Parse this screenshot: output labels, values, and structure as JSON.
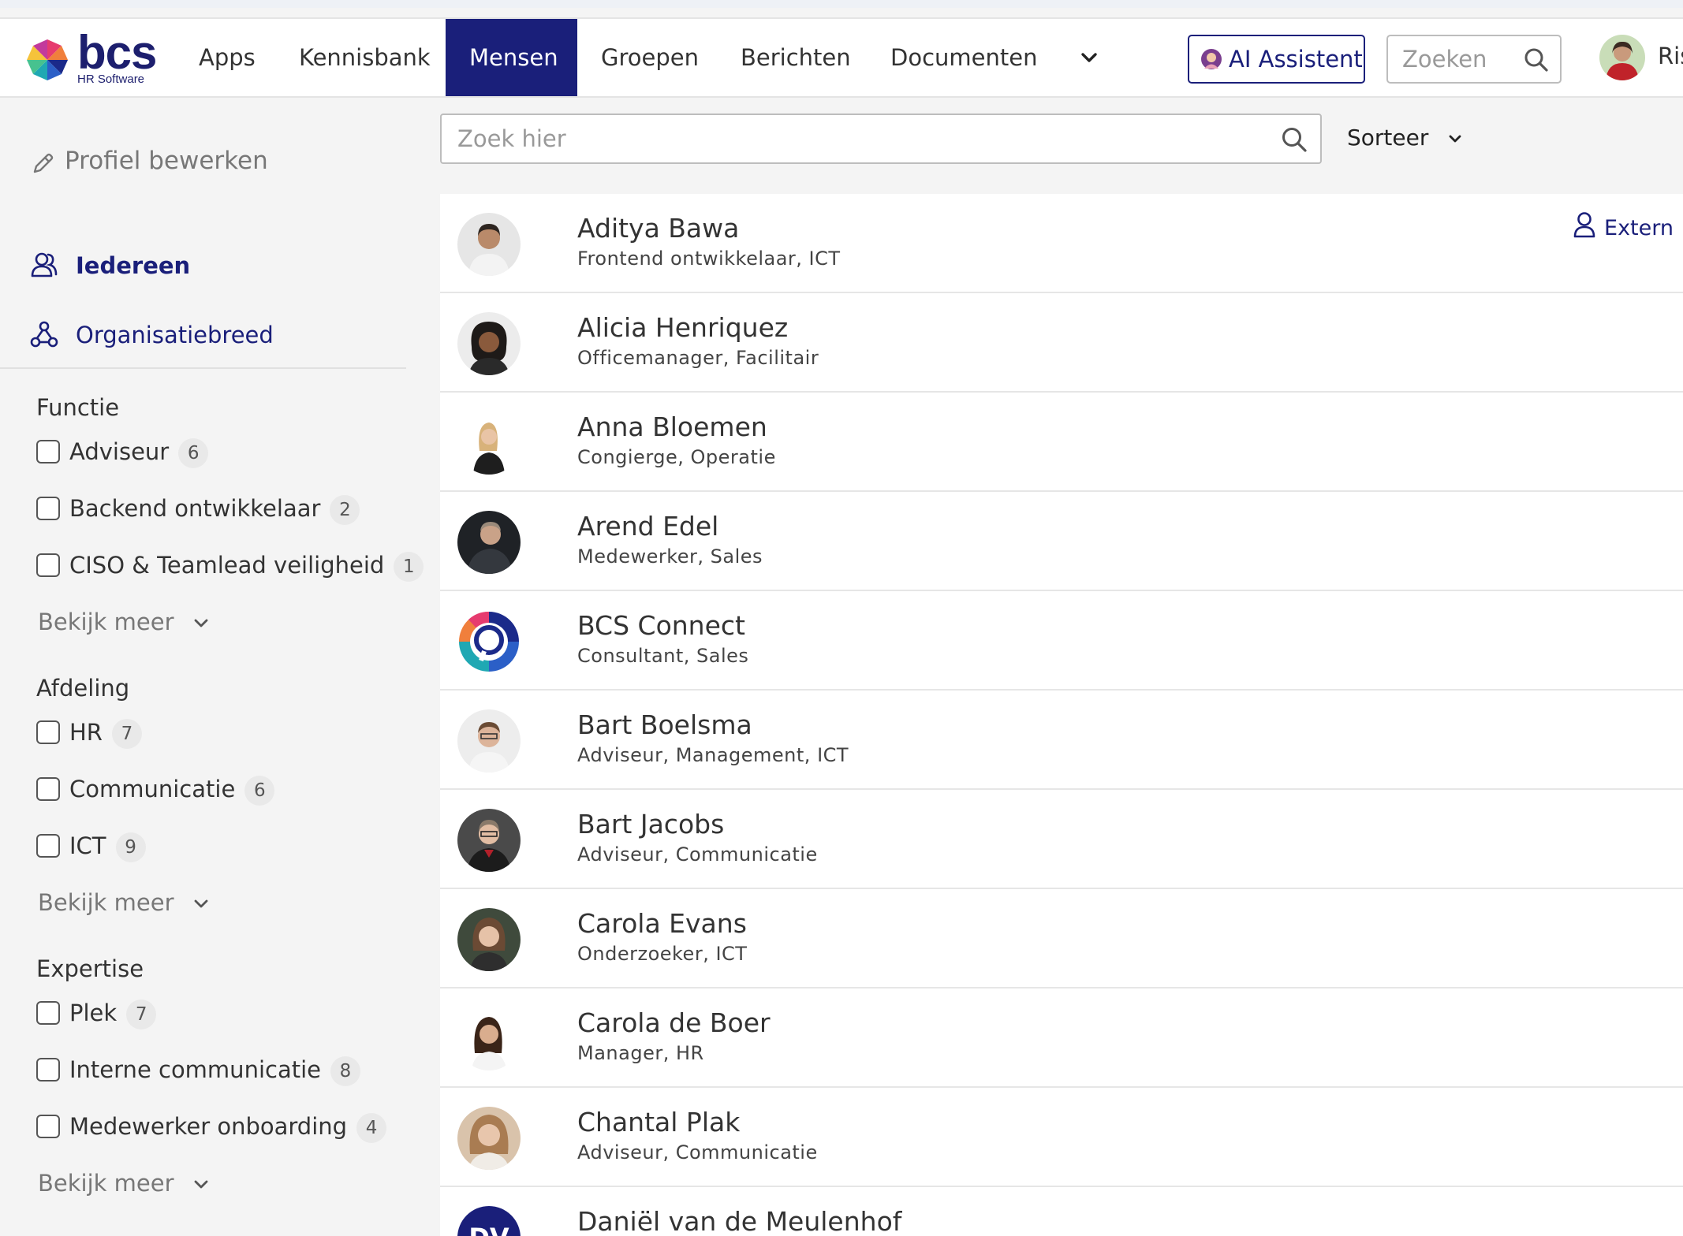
{
  "header": {
    "logo_text": "bcs",
    "logo_sub": "HR Software",
    "nav": [
      "Apps",
      "Kennisbank",
      "Mensen",
      "Groepen",
      "Berichten",
      "Documenten"
    ],
    "active_nav": "Mensen",
    "ai_label": "AI Assistent",
    "search_placeholder": "Zoeken",
    "user_name": "Ris"
  },
  "sidebar": {
    "edit_profile": "Profiel bewerken",
    "link_everyone": "Iedereen",
    "link_org": "Organisatiebreed",
    "see_more": "Bekijk meer",
    "groups": [
      {
        "title": "Functie",
        "options": [
          {
            "label": "Adviseur",
            "count": "6"
          },
          {
            "label": "Backend ontwikkelaar",
            "count": "2"
          },
          {
            "label": "CISO & Teamlead veiligheid",
            "count": "1"
          }
        ]
      },
      {
        "title": "Afdeling",
        "options": [
          {
            "label": "HR",
            "count": "7"
          },
          {
            "label": "Communicatie",
            "count": "6"
          },
          {
            "label": "ICT",
            "count": "9"
          }
        ]
      },
      {
        "title": "Expertise",
        "options": [
          {
            "label": "Plek",
            "count": "7"
          },
          {
            "label": "Interne communicatie",
            "count": "8"
          },
          {
            "label": "Medewerker onboarding",
            "count": "4"
          }
        ]
      }
    ]
  },
  "main": {
    "search_placeholder": "Zoek hier",
    "sort_label": "Sorteer",
    "extern_label": "Extern",
    "people": [
      {
        "name": "Aditya Bawa",
        "role": "Frontend ontwikkelaar, ICT",
        "extern": true
      },
      {
        "name": "Alicia Henriquez",
        "role": "Officemanager, Facilitair"
      },
      {
        "name": "Anna Bloemen",
        "role": "Congierge, Operatie"
      },
      {
        "name": "Arend Edel",
        "role": "Medewerker, Sales"
      },
      {
        "name": "BCS Connect",
        "role": "Consultant, Sales"
      },
      {
        "name": "Bart Boelsma",
        "role": "Adviseur, Management, ICT"
      },
      {
        "name": "Bart Jacobs",
        "role": "Adviseur, Communicatie"
      },
      {
        "name": "Carola Evans",
        "role": "Onderzoeker, ICT"
      },
      {
        "name": "Carola de Boer",
        "role": "Manager, HR"
      },
      {
        "name": "Chantal Plak",
        "role": "Adviseur, Communicatie"
      },
      {
        "name": "Daniël van de Meulenhof",
        "role": "",
        "initials": "DV"
      }
    ]
  },
  "colors": {
    "brand": "#1a1f7a",
    "accent_text": "#1a1f7a"
  }
}
